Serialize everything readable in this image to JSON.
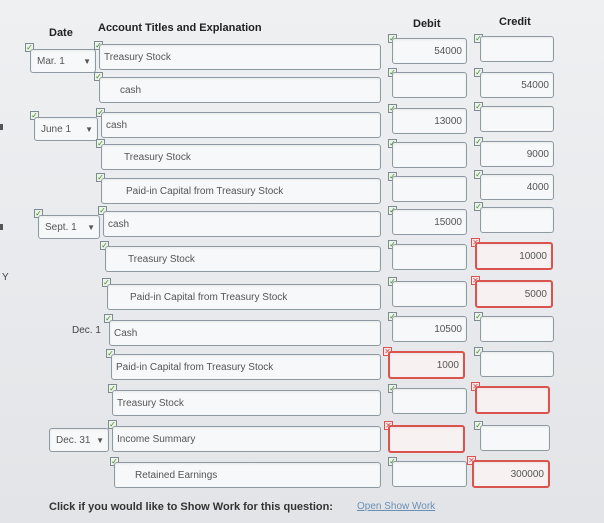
{
  "headers": {
    "date": "Date",
    "account": "Account Titles and Explanation",
    "debit": "Debit",
    "credit": "Credit"
  },
  "rows": [
    {
      "date": "Mar. 1",
      "account": "Treasury Stock",
      "debit": "54000",
      "credit": ""
    },
    {
      "date": "",
      "account": "cash",
      "debit": "",
      "credit": "54000"
    },
    {
      "date": "June 1",
      "account": "cash",
      "debit": "13000",
      "credit": ""
    },
    {
      "date": "",
      "account": "Treasury Stock",
      "debit": "",
      "credit": "9000"
    },
    {
      "date": "",
      "account": "Paid-in Capital from Treasury Stock",
      "debit": "",
      "credit": "4000"
    },
    {
      "date": "Sept. 1",
      "account": "cash",
      "debit": "15000",
      "credit": ""
    },
    {
      "date": "",
      "account": "Treasury Stock",
      "debit": "",
      "credit": "10000"
    },
    {
      "date": "",
      "account": "Paid-in Capital from Treasury Stock",
      "debit": "",
      "credit": "5000"
    },
    {
      "date": "Dec. 1",
      "account": "Cash",
      "debit": "10500",
      "credit": ""
    },
    {
      "date": "",
      "account": "Paid-in Capital from Treasury Stock",
      "debit": "1000",
      "credit": ""
    },
    {
      "date": "",
      "account": "Treasury Stock",
      "debit": "",
      "credit": ""
    },
    {
      "date": "Dec. 31",
      "account": "Income Summary",
      "debit": "",
      "credit": ""
    },
    {
      "date": "",
      "account": "Retained Earnings",
      "debit": "",
      "credit": "300000"
    }
  ],
  "footer": {
    "prompt": "Click if you would like to Show Work for this question:",
    "link": "Open Show Work"
  },
  "edge": {
    "letter": "Y"
  },
  "icons": {
    "check": "check-icon",
    "cross": "cross-icon",
    "chevron": "chevron-down-icon"
  },
  "colors": {
    "error": "#d9534f",
    "check": "#3d8a2e",
    "link": "#6b8fb3"
  }
}
